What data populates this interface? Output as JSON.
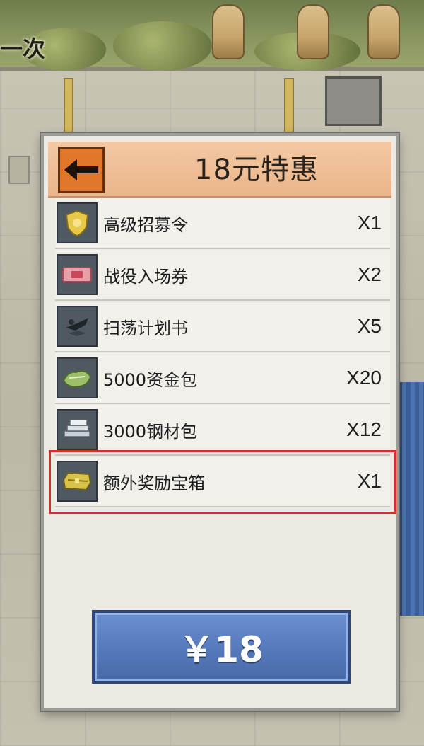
{
  "background": {
    "top_text": "一次"
  },
  "dialog": {
    "title": "18元特惠",
    "back_icon": "left-arrow-icon",
    "items": [
      {
        "icon": "shield-badge-icon",
        "name": "高级招募令",
        "qty": "X1",
        "highlighted": false
      },
      {
        "icon": "ticket-icon",
        "name": "战役入场券",
        "qty": "X2",
        "highlighted": false
      },
      {
        "icon": "aircraft-icon",
        "name": "扫荡计划书",
        "qty": "X5",
        "highlighted": false
      },
      {
        "icon": "money-pack-icon",
        "name": "5000资金包",
        "qty": "X20",
        "highlighted": false
      },
      {
        "icon": "steel-bars-icon",
        "name": "3000钢材包",
        "qty": "X12",
        "highlighted": false
      },
      {
        "icon": "treasure-chest-icon",
        "name": "额外奖励宝箱",
        "qty": "X1",
        "highlighted": true
      }
    ],
    "price_label": "￥18"
  },
  "colors": {
    "header": "#eab58a",
    "back_button": "#e0772a",
    "price_button": "#5579bb",
    "highlight_outline": "#e02a2a"
  }
}
